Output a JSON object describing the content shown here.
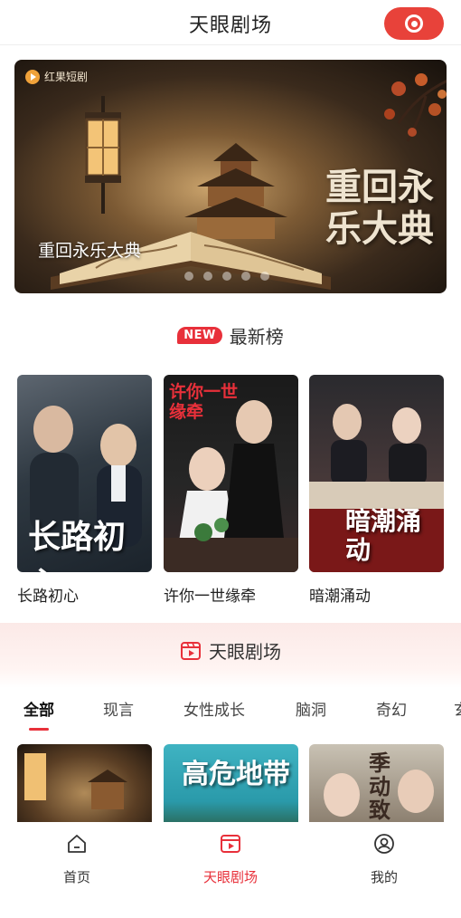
{
  "header": {
    "title": "天眼剧场",
    "record_icon": "record-icon"
  },
  "banner": {
    "brand": "红果短剧",
    "art_title": "重回永乐大典",
    "caption": "重回永乐大典",
    "slide_count": 5,
    "active_slide": 1
  },
  "latest": {
    "badge": "NEW",
    "title": "最新榜",
    "items": [
      {
        "label": "长路初心",
        "poster_text": "长路初心"
      },
      {
        "label": "许你一世缘牵",
        "poster_text": "许你一世缘牵"
      },
      {
        "label": "暗潮涌动",
        "poster_text": "暗潮涌动"
      }
    ]
  },
  "theater": {
    "title": "天眼剧场",
    "tabs": [
      "全部",
      "现言",
      "女性成长",
      "脑洞",
      "奇幻",
      "玄"
    ],
    "active_tab": 0,
    "cards": [
      {
        "poster_text": ""
      },
      {
        "poster_text": "高危地带"
      },
      {
        "poster_text": "季动致焰"
      }
    ]
  },
  "nav": {
    "items": [
      {
        "label": "首页",
        "icon": "home-icon"
      },
      {
        "label": "天眼剧场",
        "icon": "theater-icon"
      },
      {
        "label": "我的",
        "icon": "profile-icon"
      }
    ],
    "active": 1
  },
  "colors": {
    "accent": "#e8303a",
    "record": "#e8423a"
  }
}
